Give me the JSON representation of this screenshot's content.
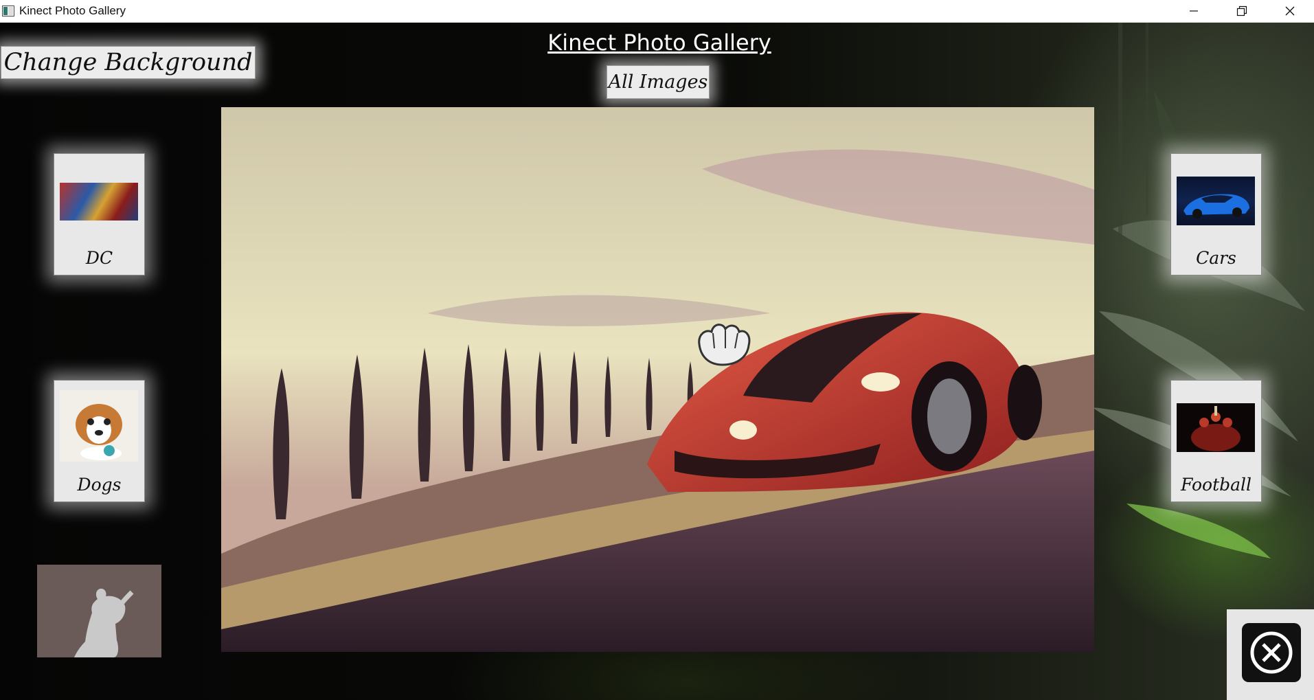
{
  "window": {
    "title": "Kinect Photo Gallery",
    "controls": [
      "minimize-icon",
      "restore-icon",
      "close-icon"
    ]
  },
  "header": {
    "title": "Kinect Photo Gallery",
    "change_background_label": "Change Background",
    "all_images_label": "All Images"
  },
  "categories": [
    {
      "label": "DC",
      "icon": "superman-thumbnail",
      "side": "left"
    },
    {
      "label": "Dogs",
      "icon": "puppy-thumbnail",
      "side": "left"
    },
    {
      "label": "Cars",
      "icon": "blue-car-thumbnail",
      "side": "right"
    },
    {
      "label": "Football",
      "icon": "football-team-thumbnail",
      "side": "right"
    }
  ],
  "main_photo": {
    "subject": "red sports car on road"
  },
  "colors": {
    "button_face": "#ececec",
    "background": "#000000",
    "close_button": "#111111"
  }
}
